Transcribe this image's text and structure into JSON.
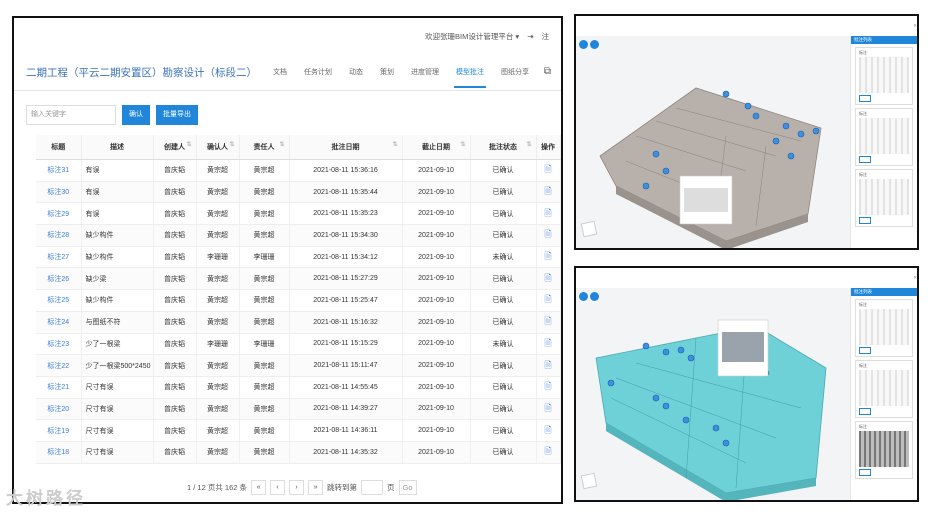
{
  "header": {
    "welcome": "欢迎张珊BIM设计管理平台 ▾",
    "exit_label": "注"
  },
  "project": {
    "title": "二期工程（平云二期安置区）勘察设计（标段二）"
  },
  "nav_tabs": [
    {
      "label": "文档"
    },
    {
      "label": "任务计划"
    },
    {
      "label": "动态"
    },
    {
      "label": "策划"
    },
    {
      "label": "进度管理"
    },
    {
      "label": "模型批注",
      "active": true
    },
    {
      "label": "图纸分享"
    }
  ],
  "search": {
    "placeholder": "输入关键字",
    "button": "确认",
    "export_button": "批量导出"
  },
  "table": {
    "columns": [
      "标题",
      "描述",
      "创建人",
      "确认人",
      "责任人",
      "批注日期",
      "截止日期",
      "批注状态",
      "操作"
    ],
    "rows": [
      {
        "title": "标注31",
        "desc": "有误",
        "creator": "曾庆韬",
        "confirmer": "黄宗超",
        "owner": "黄宗超",
        "date": "2021-08-11 15:36:16",
        "deadline": "2021-09-10",
        "status": "已确认"
      },
      {
        "title": "标注30",
        "desc": "有误",
        "creator": "曾庆韬",
        "confirmer": "黄宗超",
        "owner": "黄宗超",
        "date": "2021-08-11 15:35:44",
        "deadline": "2021-09-10",
        "status": "已确认"
      },
      {
        "title": "标注29",
        "desc": "有误",
        "creator": "曾庆韬",
        "confirmer": "黄宗超",
        "owner": "黄宗超",
        "date": "2021-08-11 15:35:23",
        "deadline": "2021-09-10",
        "status": "已确认"
      },
      {
        "title": "标注28",
        "desc": "缺少构件",
        "creator": "曾庆韬",
        "confirmer": "黄宗超",
        "owner": "黄宗超",
        "date": "2021-08-11 15:34:30",
        "deadline": "2021-09-10",
        "status": "已确认"
      },
      {
        "title": "标注27",
        "desc": "缺少构件",
        "creator": "曾庆韬",
        "confirmer": "李珊珊",
        "owner": "李珊珊",
        "date": "2021-08-11 15:34:12",
        "deadline": "2021-09-10",
        "status": "未确认"
      },
      {
        "title": "标注26",
        "desc": "缺少梁",
        "creator": "曾庆韬",
        "confirmer": "黄宗超",
        "owner": "黄宗超",
        "date": "2021-08-11 15:27:29",
        "deadline": "2021-09-10",
        "status": "已确认"
      },
      {
        "title": "标注25",
        "desc": "缺少构件",
        "creator": "曾庆韬",
        "confirmer": "黄宗超",
        "owner": "黄宗超",
        "date": "2021-08-11 15:25:47",
        "deadline": "2021-09-10",
        "status": "已确认"
      },
      {
        "title": "标注24",
        "desc": "与图纸不符",
        "creator": "曾庆韬",
        "confirmer": "黄宗超",
        "owner": "黄宗超",
        "date": "2021-08-11 15:16:32",
        "deadline": "2021-09-10",
        "status": "已确认"
      },
      {
        "title": "标注23",
        "desc": "少了一根梁",
        "creator": "曾庆韬",
        "confirmer": "李珊珊",
        "owner": "李珊珊",
        "date": "2021-08-11 15:15:29",
        "deadline": "2021-09-10",
        "status": "未确认"
      },
      {
        "title": "标注22",
        "desc": "少了一根梁500*2450",
        "creator": "曾庆韬",
        "confirmer": "黄宗超",
        "owner": "黄宗超",
        "date": "2021-08-11 15:11:47",
        "deadline": "2021-09-10",
        "status": "已确认"
      },
      {
        "title": "标注21",
        "desc": "尺寸有误",
        "creator": "曾庆韬",
        "confirmer": "黄宗超",
        "owner": "黄宗超",
        "date": "2021-08-11 14:55:45",
        "deadline": "2021-09-10",
        "status": "已确认"
      },
      {
        "title": "标注20",
        "desc": "尺寸有误",
        "creator": "曾庆韬",
        "confirmer": "黄宗超",
        "owner": "黄宗超",
        "date": "2021-08-11 14:39:27",
        "deadline": "2021-09-10",
        "status": "已确认"
      },
      {
        "title": "标注19",
        "desc": "尺寸有误",
        "creator": "曾庆韬",
        "confirmer": "黄宗超",
        "owner": "黄宗超",
        "date": "2021-08-11 14:36:11",
        "deadline": "2021-09-10",
        "status": "已确认"
      },
      {
        "title": "标注18",
        "desc": "尺寸有误",
        "creator": "曾庆韬",
        "confirmer": "黄宗超",
        "owner": "黄宗超",
        "date": "2021-08-11 14:35:32",
        "deadline": "2021-09-10",
        "status": "已确认"
      }
    ]
  },
  "pager": {
    "summary": "1 / 12 页共 162 条",
    "first": "«",
    "prev": "‹",
    "next": "›",
    "last": "»",
    "jump_label": "跳转到第",
    "page_unit": "页",
    "go": "Go"
  },
  "viewer": {
    "panel_title": "批注列表",
    "card_label": "标注"
  },
  "watermark": "大树路径",
  "colors": {
    "accent": "#1f86d9",
    "model_gray": "#b8b0aa",
    "model_cyan": "#6fd1d8"
  }
}
